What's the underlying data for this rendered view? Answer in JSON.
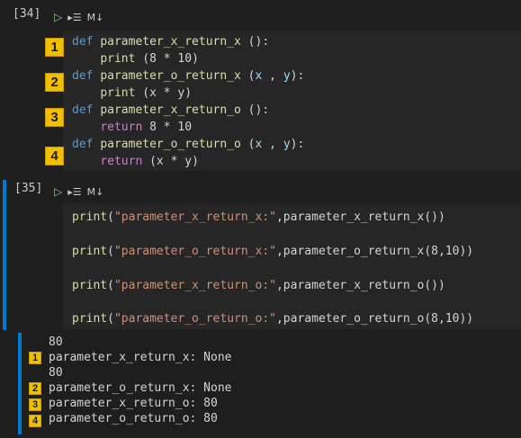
{
  "cells": [
    {
      "exec_count": "[34]",
      "toolbar": {
        "run_icon": "play-icon",
        "run_above_icon": "run-below-icon",
        "markdown_label": "M↓"
      },
      "code": [
        {
          "kw": "def",
          "name": "parameter_x_return_x",
          "rest": " ():"
        },
        {
          "indent": "    ",
          "call": "print",
          "rest": " (8 * 10)"
        },
        {
          "kw": "def",
          "name": "parameter_o_return_x",
          "rest1": " (",
          "a": "x",
          "sep": " , ",
          "b": "y",
          "rest2": "):"
        },
        {
          "indent": "    ",
          "call": "print",
          "rest": " (x * y)"
        },
        {
          "kw": "def",
          "name": "parameter_x_return_o",
          "rest": " ():"
        },
        {
          "indent": "    ",
          "ret": "return",
          "rest": " 8 * 10"
        },
        {
          "kw": "def",
          "name": "parameter_o_return_o",
          "rest1": " (",
          "a": "x",
          "sep": " , ",
          "b": "y",
          "rest2": "):"
        },
        {
          "indent": "    ",
          "ret": "return",
          "rest": " (x * y)"
        }
      ],
      "badges": [
        "1",
        "2",
        "3",
        "4"
      ]
    },
    {
      "exec_count": "[35]",
      "toolbar": {
        "run_icon": "play-icon",
        "run_above_icon": "run-below-icon",
        "markdown_label": "M↓"
      },
      "code": [
        {
          "fn": "print",
          "open": "(",
          "str": "\"parameter_x_return_x:\"",
          "tail": ",parameter_x_return_x())"
        },
        {
          "fn": "print",
          "open": "(",
          "str": "\"parameter_o_return_x:\"",
          "tail": ",parameter_o_return_x(8,10))"
        },
        {
          "fn": "print",
          "open": "(",
          "str": "\"parameter_x_return_o:\"",
          "tail": ",parameter_x_return_o())"
        },
        {
          "fn": "print",
          "open": "(",
          "str": "\"parameter_o_return_o:\"",
          "tail": ",parameter_o_return_o(8,10))"
        }
      ],
      "output": [
        "80",
        "parameter_x_return_x: None",
        "80",
        "parameter_o_return_x: None",
        "parameter_x_return_o: 80",
        "parameter_o_return_o: 80"
      ],
      "output_badges": [
        "1",
        "2",
        "3",
        "4"
      ]
    }
  ],
  "colors": {
    "accent_bar": "#007acc",
    "badge": "#f0c000"
  }
}
